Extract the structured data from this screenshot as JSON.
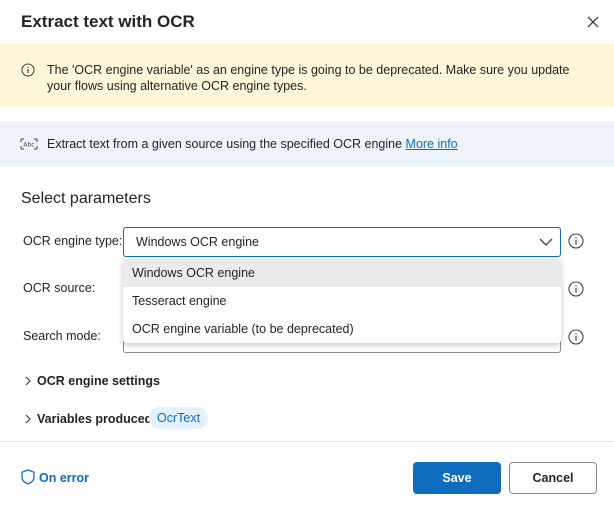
{
  "dialog": {
    "title": "Extract text with OCR"
  },
  "warning": {
    "text": "The 'OCR engine variable' as an engine type is going to be deprecated.  Make sure you update your flows using alternative OCR engine types."
  },
  "info": {
    "text": "Extract text from a given source using the specified OCR engine",
    "link": "More info"
  },
  "parameters": {
    "heading": "Select parameters",
    "engine_type_label": "OCR engine type:",
    "engine_type_value": "Windows OCR engine",
    "ocr_source_label": "OCR source:",
    "search_mode_label": "Search mode:",
    "dropdown_options": [
      "Windows OCR engine",
      "Tesseract engine",
      "OCR engine variable (to be deprecated)"
    ]
  },
  "sections": {
    "engine_settings": "OCR engine settings",
    "variables_produced": "Variables produced",
    "variable_tag": "OcrText"
  },
  "footer": {
    "on_error": "On error",
    "save": "Save",
    "cancel": "Cancel"
  },
  "colors": {
    "accent": "#0f6cbd",
    "warning_bg": "#fdf6d9",
    "info_bg": "#eef3fa"
  }
}
